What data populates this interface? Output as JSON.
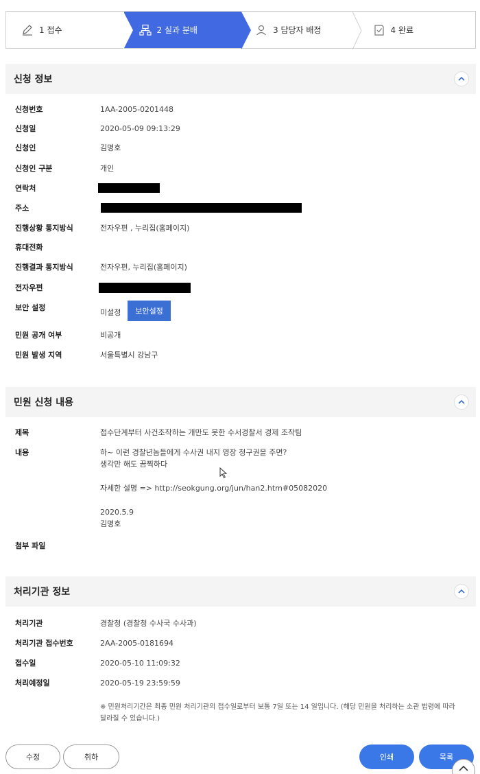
{
  "stepper": {
    "steps": [
      {
        "label": "1 접수"
      },
      {
        "label": "2 실과 분배"
      },
      {
        "label": "3 담당자 배정"
      },
      {
        "label": "4 완료"
      }
    ],
    "active_color": "#4169e1"
  },
  "application_info": {
    "title": "신청 정보",
    "rows": {
      "number": {
        "label": "신청번호",
        "value": "1AA-2005-0201448"
      },
      "date": {
        "label": "신청일",
        "value": "2020-05-09 09:13:29"
      },
      "applicant": {
        "label": "신청인",
        "value": "김명호"
      },
      "type": {
        "label": "신청인 구분",
        "value": "개인"
      },
      "contact": {
        "label": "연락처"
      },
      "address": {
        "label": "주소"
      },
      "notify_progress": {
        "label": "진행상황 통지방식",
        "value": "전자우편 , 누리집(홈페이지)"
      },
      "mobile": {
        "label": "휴대전화"
      },
      "notify_result": {
        "label": "진행결과 통지방식",
        "value": "전자우편, 누리집(홈페이지)"
      },
      "email": {
        "label": "전자우편"
      },
      "security": {
        "label": "보안 설정",
        "value": "미설정",
        "button": "보안설정"
      },
      "disclosure": {
        "label": "민원 공개 여부",
        "value": "비공개"
      },
      "region": {
        "label": "민원 발생 지역",
        "value": "서울특별시 강남구"
      }
    }
  },
  "complaint": {
    "title": "민원 신청 내용",
    "subject_label": "제목",
    "subject": "접수단계부터 사건조작하는 개만도 못한 수서경찰서 경제 조작팀",
    "content_label": "내용",
    "content_lines": [
      "하~ 이런 경찰년놈들에게 수사권 내지 영장 청구권을 주면?",
      "생각만 해도 끔찍하다",
      "자세한 설명 => http://seokgung.org/jun/han2.htm#05082020",
      "2020.5.9",
      "김명호"
    ],
    "attachment_label": "첨부 파일"
  },
  "agency": {
    "title": "처리기관 정보",
    "rows": {
      "agency": {
        "label": "처리기관",
        "value": "경찰청 (경찰청 수사국 수사과)"
      },
      "receipt_no": {
        "label": "처리기관 접수번호",
        "value": "2AA-2005-0181694"
      },
      "receipt_date": {
        "label": "접수일",
        "value": "2020-05-10 11:09:32"
      },
      "due_date": {
        "label": "처리예정일",
        "value": "2020-05-19 23:59:59"
      }
    },
    "note_line1": "※ 민원처리기간은 최종 민원 처리기관의 접수일로부터 보통 7일 또는 14 일입니다. (해당 민원을 처리하는 소관 법령에 따라",
    "note_line2": "달라질 수 있습니다.)"
  },
  "actions": {
    "edit": "수정",
    "withdraw": "취하",
    "print": "인쇄",
    "list": "목록"
  }
}
